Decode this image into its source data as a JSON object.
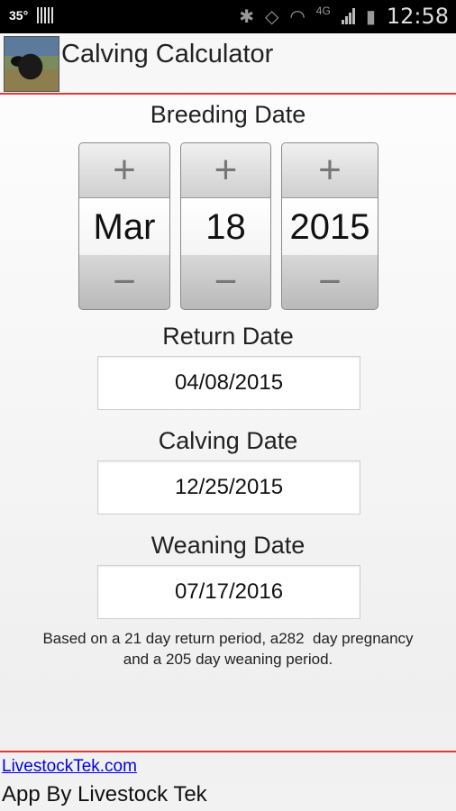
{
  "status_bar": {
    "temperature": "35°",
    "network": "4G",
    "time": "12:58"
  },
  "app": {
    "title": "Calving Calculator"
  },
  "breeding": {
    "label": "Breeding Date",
    "month": "Mar",
    "day": "18",
    "year": "2015",
    "plus_symbol": "+",
    "minus_symbol": "−"
  },
  "return": {
    "label": "Return Date",
    "value": "04/08/2015"
  },
  "calving": {
    "label": "Calving Date",
    "value": "12/25/2015"
  },
  "weaning": {
    "label": "Weaning Date",
    "value": "07/17/2016"
  },
  "note": {
    "line1": "Based on a 21 day return period, a282  day pregnancy",
    "line2": "and a 205 day weaning period."
  },
  "footer": {
    "link": "LivestockTek.com",
    "byline": "App By Livestock Tek"
  },
  "colors": {
    "accent_line": "#e53935",
    "link": "#0000ee"
  }
}
